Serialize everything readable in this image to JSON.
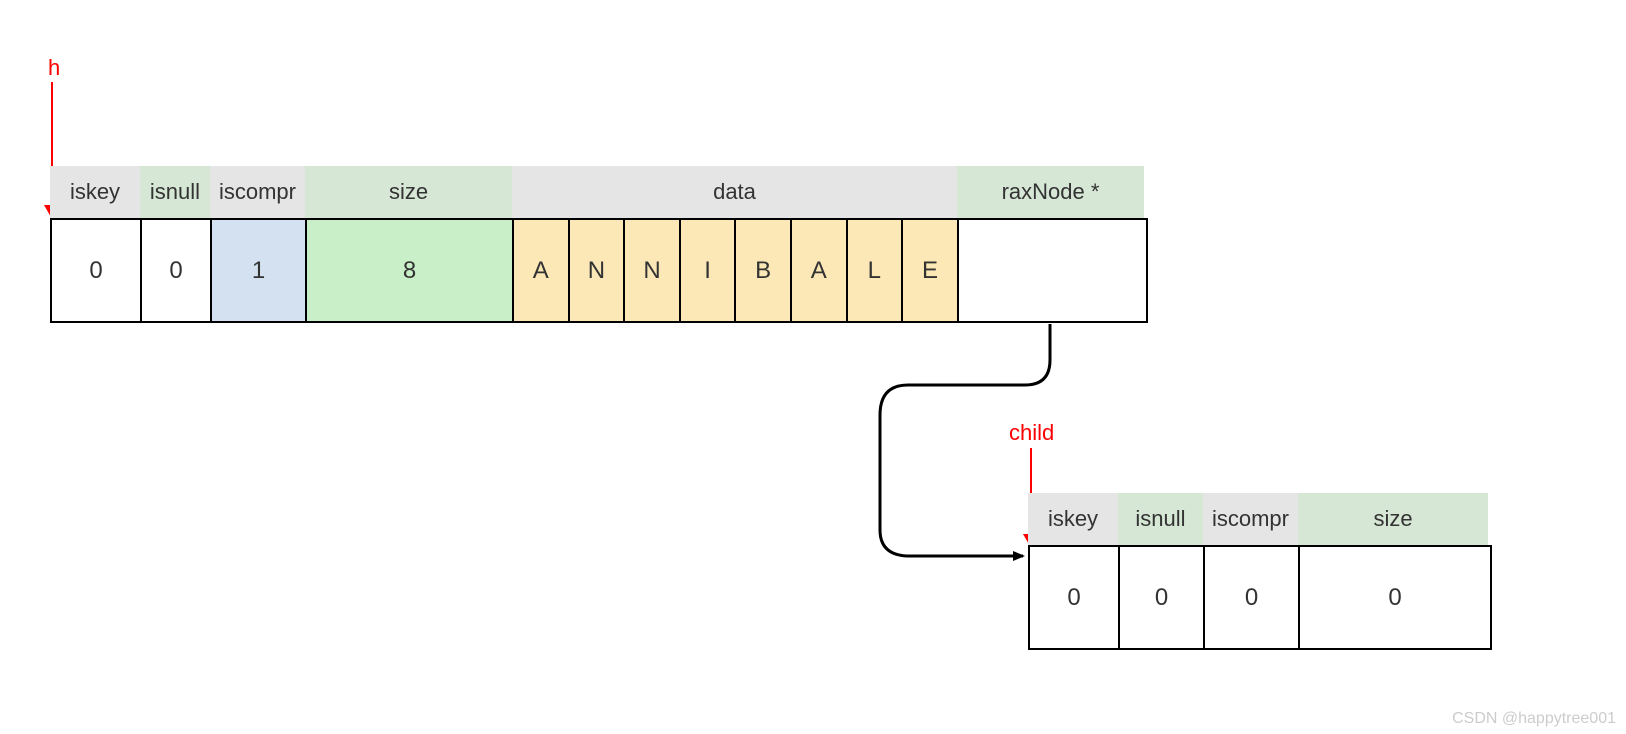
{
  "labels": {
    "h": "h",
    "child": "child"
  },
  "node1": {
    "headers": {
      "iskey": "iskey",
      "isnull": "isnull",
      "iscompr": "iscompr",
      "size": "size",
      "data": "data",
      "raxnode": "raxNode *"
    },
    "values": {
      "iskey": "0",
      "isnull": "0",
      "iscompr": "1",
      "size": "8",
      "data": [
        "A",
        "N",
        "N",
        "I",
        "B",
        "A",
        "L",
        "E"
      ]
    }
  },
  "node2": {
    "headers": {
      "iskey": "iskey",
      "isnull": "isnull",
      "iscompr": "iscompr",
      "size": "size"
    },
    "values": {
      "iskey": "0",
      "isnull": "0",
      "iscompr": "0",
      "size": "0"
    }
  },
  "credit": "CSDN @happytree001"
}
